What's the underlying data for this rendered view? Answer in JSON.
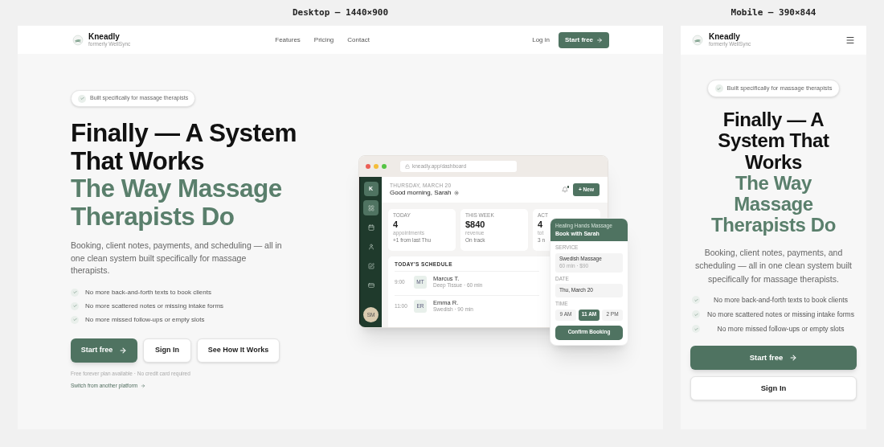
{
  "desktop": {
    "label": "Desktop — 1440×900",
    "nav": {
      "brand": "Kneadly",
      "tagline": "formerly WellSync",
      "links": [
        "Features",
        "Pricing",
        "Contact"
      ],
      "login": "Log in",
      "cta": "Start free"
    },
    "hero": {
      "badge": "Built specifically for massage therapists",
      "headline_dark": [
        "Finally — A System",
        "That Works"
      ],
      "headline_accent": [
        "The Way Massage",
        "Therapists Do"
      ],
      "paragraph": "Booking, client notes, payments, and scheduling — all in one clean system built specifically for massage therapists.",
      "checks": [
        "No more back-and-forth texts to book clients",
        "No more scattered notes or missing intake forms",
        "No more missed follow-ups or empty slots"
      ],
      "buttons": [
        {
          "label": "Start free",
          "kind": "primary"
        },
        {
          "label": "Sign In",
          "kind": "secondary"
        },
        {
          "label": "See How It Works",
          "kind": "secondary"
        }
      ],
      "note": "Free forever plan available · No credit card required",
      "switch_link": "Switch from another platform"
    },
    "dashboard": {
      "url": "kneadly.app/dashboard",
      "logo": "K",
      "user": "SM",
      "date": "THURSDAY, MARCH 20",
      "greeting": "Good morning, Sarah",
      "new_button": "+ New",
      "stats": [
        {
          "label": "TODAY",
          "value": "4",
          "caption": "appointments",
          "note": "+1 from last Thu"
        },
        {
          "label": "THIS WEEK",
          "value": "$840",
          "caption": "revenue",
          "note": "On track"
        },
        {
          "label": "ACT",
          "value": "4",
          "caption": "tot",
          "note": "3 n"
        }
      ],
      "schedule_title": "TODAY'S SCHEDULE",
      "rows": [
        {
          "time": "9:00",
          "initials": "MT",
          "name": "Marcus T.",
          "detail": "Deep Tissue · 60 min"
        },
        {
          "time": "11:00",
          "initials": "ER",
          "name": "Emma R.",
          "detail": "Swedish · 90 min"
        }
      ],
      "booking": {
        "business": "Healing Hands Massage",
        "title": "Book with Sarah",
        "service_label": "SERVICE",
        "service": "Swedish Massage",
        "service_detail": "60 min · $90",
        "date_label": "DATE",
        "date": "Thu, March 20",
        "time_label": "TIME",
        "times": [
          {
            "label": "9 AM",
            "selected": false
          },
          {
            "label": "11 AM",
            "selected": true
          },
          {
            "label": "2 PM",
            "selected": false
          }
        ],
        "confirm": "Confirm Booking"
      }
    }
  },
  "mobile": {
    "label": "Mobile — 390×844",
    "nav": {
      "brand": "Kneadly",
      "tagline": "formerly WellSync"
    },
    "hero": {
      "badge": "Built specifically for massage therapists",
      "headline_dark": [
        "Finally — A",
        "System That",
        "Works"
      ],
      "headline_accent": [
        "The Way",
        "Massage",
        "Therapists Do"
      ],
      "paragraph": "Booking, client notes, payments, and scheduling — all in one clean system built specifically for massage therapists.",
      "checks": [
        "No more back-and-forth texts to book clients",
        "No more scattered notes or missing intake forms",
        "No more missed follow-ups or empty slots"
      ],
      "buttons": [
        {
          "label": "Start free",
          "kind": "primary"
        },
        {
          "label": "Sign In",
          "kind": "secondary"
        }
      ]
    }
  }
}
